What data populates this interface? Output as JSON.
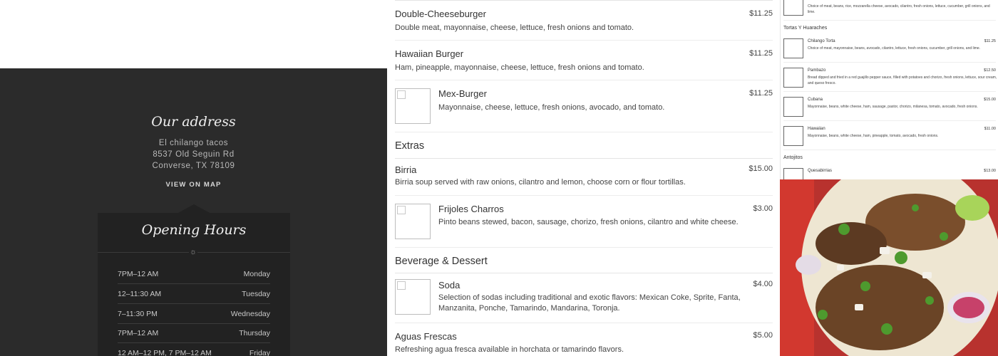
{
  "address": {
    "title": "Our address",
    "line1": "El chilango tacos",
    "line2": "8537 Old Seguin Rd",
    "line3": "Converse, TX 78109",
    "map_link": "VIEW ON MAP"
  },
  "hours": {
    "title": "Opening Hours",
    "icon": "sun-icon",
    "rows": [
      {
        "time": "7PM–12 AM",
        "day": "Monday"
      },
      {
        "time": "12–11:30 AM",
        "day": "Tuesday"
      },
      {
        "time": "7–11:30 PM",
        "day": "Wednesday"
      },
      {
        "time": "7PM–12 AM",
        "day": "Thursday"
      },
      {
        "time": "12 AM–12 PM, 7 PM–12 AM",
        "day": "Friday"
      }
    ]
  },
  "menu": {
    "burgers": [
      {
        "name": "Double-Cheeseburger",
        "price": "$11.25",
        "desc": "Double meat, mayonnaise, cheese, lettuce, fresh onions and tomato."
      },
      {
        "name": "Hawaiian Burger",
        "price": "$11.25",
        "desc": "Ham, pineapple, mayonnaise, cheese, lettuce, fresh onions and tomato."
      },
      {
        "name": "Mex-Burger",
        "price": "$11.25",
        "desc": "Mayonnaise, cheese, lettuce, fresh onions, avocado, and tomato."
      }
    ],
    "extras_title": "Extras",
    "extras": [
      {
        "name": "Birria",
        "price": "$15.00",
        "desc": "Birria soup served with raw onions, cilantro and lemon, choose corn or flour tortillas."
      },
      {
        "name": "Frijoles Charros",
        "price": "$3.00",
        "desc": "Pinto beans stewed, bacon, sausage, chorizo, fresh onions, cilantro and white cheese."
      }
    ],
    "beverage_title": "Beverage & Dessert",
    "beverage": [
      {
        "name": "Soda",
        "price": "$4.00",
        "desc": "Selection of sodas including traditional and exotic flavors: Mexican Coke, Sprite, Fanta, Manzanita, Ponche, Tamarindo, Mandarina, Toronja."
      },
      {
        "name": "Aguas Frescas",
        "price": "$5.00",
        "desc": "Refreshing agua fresca available in horchata or tamarindo flavors."
      }
    ]
  },
  "side_menu": {
    "top_item_desc": "Choice of meat, beans, rice, mozzarella cheese, avocado, cilantro, fresh onions, lettuce, cucumber, grill onions, and lime.",
    "tortas_title": "Tortas Y Huaraches",
    "tortas": [
      {
        "name": "Chilango Torta",
        "price": "$11.25",
        "desc": "Choice of meat, mayonnaise, beans, avocado, cilantro, lettuce, fresh onions, cucumber, grill onions, and lime."
      },
      {
        "name": "Pambazo",
        "price": "$12.50",
        "desc": "Bread dipped and fried in a red guajillo pepper sauce, filled with potatoes and chorizo, fresh onions, lettuce, sour cream, and queso fresco."
      },
      {
        "name": "Cubana",
        "price": "$15.00",
        "desc": "Mayonnaise, beans, white cheese, ham, sausage, pastor, chorizo, milanesa, tomato, avocado, fresh onions."
      },
      {
        "name": "Hawaiian",
        "price": "$11.00",
        "desc": "Mayonnaise, beans, white cheese, ham, pineapple, tomato, avocado, fresh onions."
      }
    ],
    "antojitos_title": "Antojitos",
    "antojitos": [
      {
        "name": "Quesabirrias",
        "price": "$13.00"
      }
    ]
  },
  "colors": {
    "dark_panel": "#2b2b2b",
    "hours_box": "#222222"
  }
}
